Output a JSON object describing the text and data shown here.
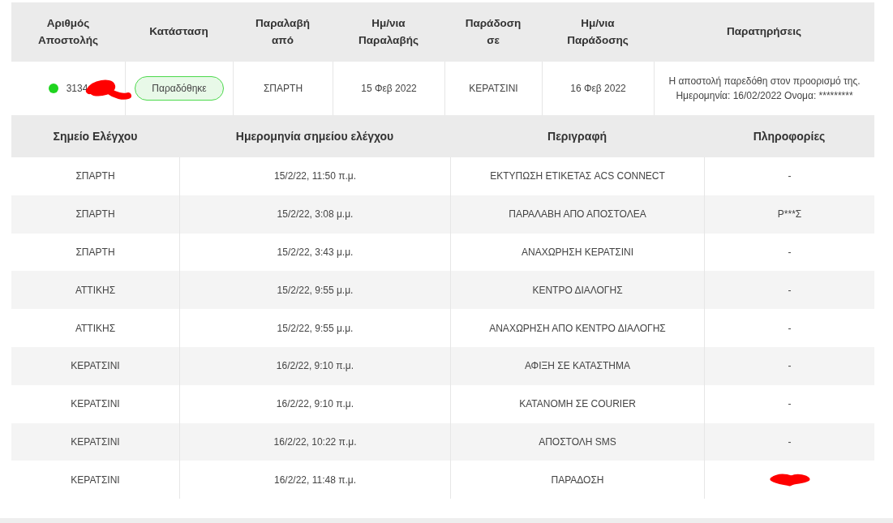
{
  "shipment_table": {
    "columns": [
      "Αριθμός Αποστολής",
      "Κατάσταση",
      "Παραλαβή από",
      "Ημ/νια Παραλαβής",
      "Παράδοση σε",
      "Ημ/νια Παράδοσης",
      "Παρατηρήσεις"
    ],
    "row": {
      "number": "3134",
      "status": "Παραδόθηκε",
      "pickup_from": "ΣΠΑΡΤΗ",
      "pickup_date": "15 Φεβ 2022",
      "delivery_to": "ΚΕΡΑΤΣΙΝΙ",
      "delivery_date": "16 Φεβ 2022",
      "remarks": [
        "Η αποστολή παρεδόθη στον προορισμό της.",
        "Ημερομηνία: 16/02/2022 Ονομα: *********"
      ]
    }
  },
  "checkpoints_table": {
    "columns": [
      "Σημείο Ελέγχου",
      "Ημερομηνία σημείου ελέγχου",
      "Περιγραφή",
      "Πληροφορίες"
    ],
    "rows": [
      {
        "point": "ΣΠΑΡΤΗ",
        "date": "15/2/22, 11:50 π.μ.",
        "description": "ΕΚΤΥΠΩΣΗ ΕΤΙΚΕΤΑΣ ACS CONNECT",
        "info": "-"
      },
      {
        "point": "ΣΠΑΡΤΗ",
        "date": "15/2/22, 3:08 μ.μ.",
        "description": "ΠΑΡΑΛΑΒΗ ΑΠΟ ΑΠΟΣΤΟΛΕΑ",
        "info": "Ρ***Σ"
      },
      {
        "point": "ΣΠΑΡΤΗ",
        "date": "15/2/22, 3:43 μ.μ.",
        "description": "ΑΝΑΧΩΡΗΣΗ ΚΕΡΑΤΣΙΝΙ",
        "info": "-"
      },
      {
        "point": "ΑΤΤΙΚΗΣ",
        "date": "15/2/22, 9:55 μ.μ.",
        "description": "ΚΕΝΤΡΟ ΔΙΑΛΟΓΗΣ",
        "info": "-"
      },
      {
        "point": "ΑΤΤΙΚΗΣ",
        "date": "15/2/22, 9:55 μ.μ.",
        "description": "ΑΝΑΧΩΡΗΣΗ ΑΠΟ ΚΕΝΤΡΟ ΔΙΑΛΟΓΗΣ",
        "info": "-"
      },
      {
        "point": "ΚΕΡΑΤΣΙΝΙ",
        "date": "16/2/22, 9:10 π.μ.",
        "description": "ΑΦΙΞΗ ΣΕ ΚΑΤΑΣΤΗΜΑ",
        "info": "-"
      },
      {
        "point": "ΚΕΡΑΤΣΙΝΙ",
        "date": "16/2/22, 9:10 π.μ.",
        "description": "ΚΑΤΑΝΟΜΗ ΣΕ COURIER",
        "info": "-"
      },
      {
        "point": "ΚΕΡΑΤΣΙΝΙ",
        "date": "16/2/22, 10:22 π.μ.",
        "description": "ΑΠΟΣΤΟΛΗ SMS",
        "info": "-"
      },
      {
        "point": "ΚΕΡΑΤΣΙΝΙ",
        "date": "16/2/22, 11:48 π.μ.",
        "description": "ΠΑΡΑΔΟΣΗ",
        "redacted": true
      }
    ]
  }
}
